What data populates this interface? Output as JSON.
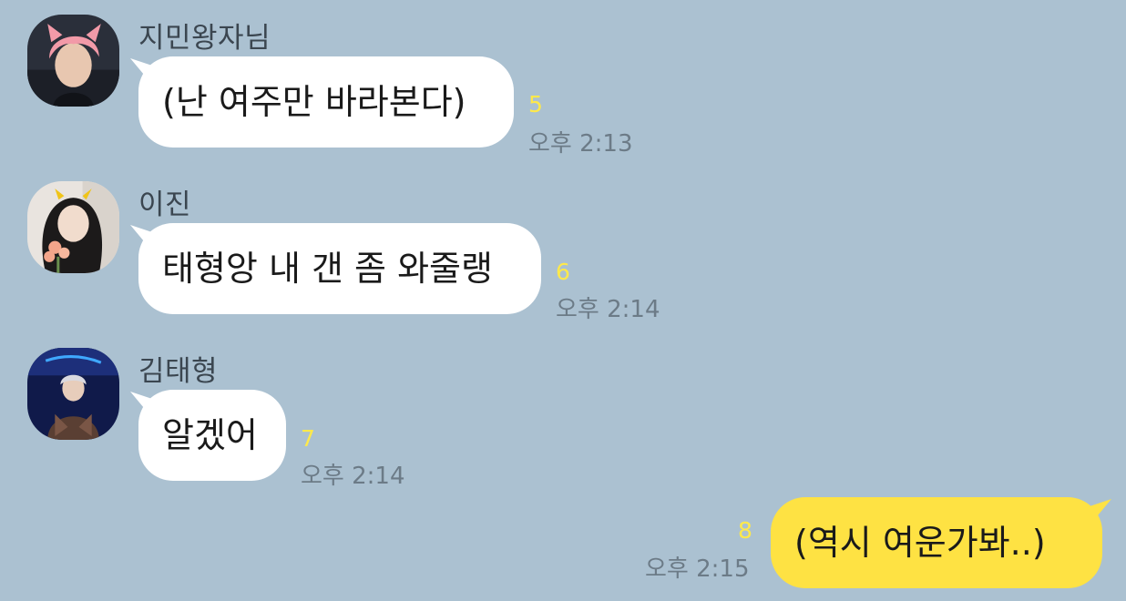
{
  "colors": {
    "background": "#abc1d1",
    "incoming_bubble": "#ffffff",
    "outgoing_bubble": "#fee243",
    "unread_count": "#ffe94a",
    "timestamp": "#6c7b87",
    "sender_name": "#3b4650"
  },
  "messages": [
    {
      "sender": "지민왕자님",
      "text": "(난 여주만 바라본다)",
      "unread": "5",
      "time": "오후 2:13",
      "avatar": "avatar-pink-hair-icon"
    },
    {
      "sender": "이진",
      "text": "태형앙 내 갠 좀 와줄랭",
      "unread": "6",
      "time": "오후 2:14",
      "avatar": "avatar-girl-with-flowers-icon"
    },
    {
      "sender": "김태형",
      "text": "알겠어",
      "unread": "7",
      "time": "오후 2:14",
      "avatar": "avatar-stage-photo-icon"
    },
    {
      "text": "(역시 여운가봐..)",
      "unread": "8",
      "time": "오후 2:15",
      "outgoing": true
    }
  ]
}
